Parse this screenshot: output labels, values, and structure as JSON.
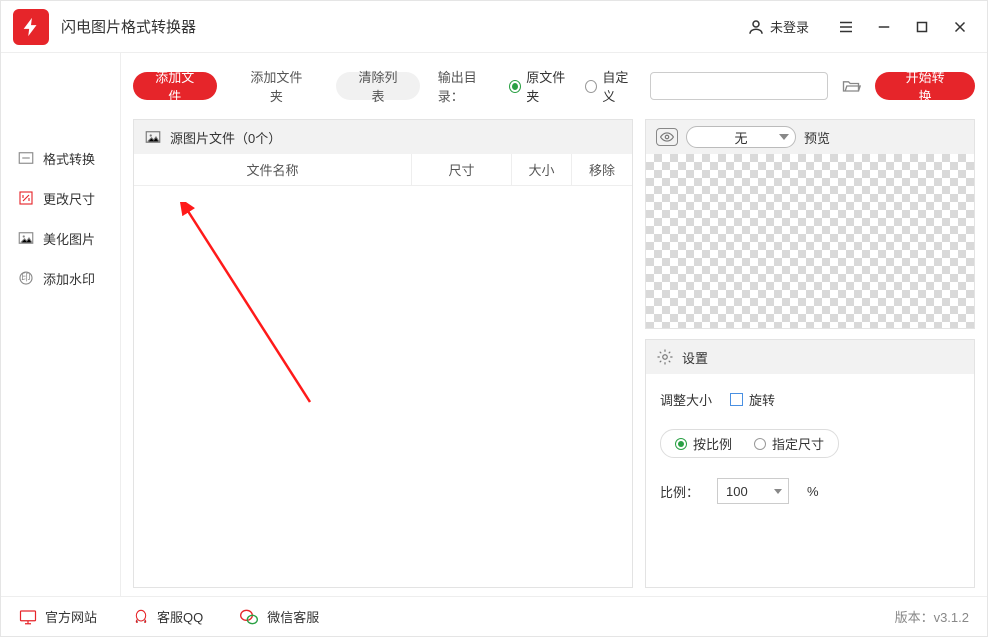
{
  "app_title": "闪电图片格式转换器",
  "login_text": "未登录",
  "sidebar": {
    "items": [
      {
        "label": "格式转换"
      },
      {
        "label": "更改尺寸"
      },
      {
        "label": "美化图片"
      },
      {
        "label": "添加水印"
      }
    ]
  },
  "toolbar": {
    "add_file": "添加文件",
    "add_folder": "添加文件夹",
    "clear_list": "清除列表",
    "output_label": "输出目录：",
    "radio_src": "原文件夹",
    "radio_custom": "自定义",
    "start": "开始转换"
  },
  "filelist": {
    "header": "源图片文件（0个）",
    "cols": {
      "name": "文件名称",
      "dim": "尺寸",
      "size": "大小",
      "remove": "移除"
    }
  },
  "preview": {
    "select_none": "无",
    "label": "预览"
  },
  "settings": {
    "title": "设置",
    "resize_label": "调整大小",
    "rotate": "旋转",
    "by_ratio": "按比例",
    "by_size": "指定尺寸",
    "ratio_label": "比例：",
    "ratio_value": "100",
    "ratio_unit": "%"
  },
  "status": {
    "website": "官方网站",
    "qq": "客服QQ",
    "wechat": "微信客服",
    "version": "版本：v3.1.2"
  }
}
